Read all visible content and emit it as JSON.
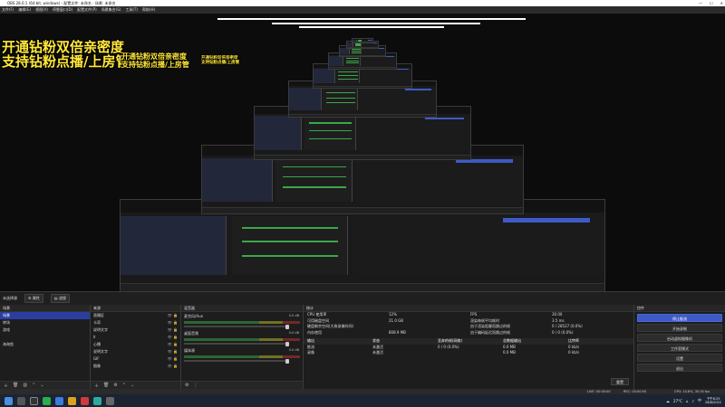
{
  "window": {
    "title": "OBS 28.0.1 (64-bit, windows) - 配置文件: 未命名 - 场景: 未命名",
    "min": "—",
    "max": "☐",
    "close": "✕"
  },
  "menu": [
    "文件(F)",
    "编辑(E)",
    "视图(V)",
    "停靠窗口(D)",
    "配置文件(P)",
    "场景集合(S)",
    "工具(T)",
    "帮助(H)"
  ],
  "overlay": {
    "line1": "开通钻粉双倍亲密度",
    "line2": "支持钻粉点播/上房管"
  },
  "scene_bar": {
    "label": "未选择源",
    "properties": "属性",
    "filters": "滤镜"
  },
  "scenes": {
    "title": "场景",
    "items": [
      "场景",
      "转场",
      "游戏",
      "",
      "海海鱼"
    ],
    "selected": 0
  },
  "sources": {
    "title": "来源",
    "items": [
      "直播区",
      "卡奇",
      "说明文字",
      "Ir",
      "心播",
      "说明文字",
      "GIF",
      "图像"
    ]
  },
  "mixer": {
    "title": "混音器",
    "channels": [
      {
        "name": "麦克风/Aux",
        "db": "0.0 dB"
      },
      {
        "name": "桌面音频",
        "db": "0.0 dB"
      },
      {
        "name": "媒体源",
        "db": "0.0 dB"
      },
      {
        "name": "说明文字",
        "db": "0.0 dB"
      }
    ]
  },
  "stats": {
    "title": "统计",
    "rows": [
      [
        "CPU 使用率",
        "12%",
        "FPS",
        "30.00"
      ],
      [
        "可用磁盘空间",
        "21.0 GB",
        "渲染每帧平均耗时",
        "3.5 ms"
      ],
      [
        "硬盘剩余空间(大致录像时间)",
        "",
        "由于渲染阻塞而跳过的帧",
        "0 / 28527 (0.0%)"
      ],
      [
        "内存使用",
        "808.9 MB",
        "由于编码延迟而跳过的帧",
        "0 / 0 (0.0%)"
      ]
    ],
    "table_head": [
      "输出",
      "状态",
      "丢弃的帧(网络)",
      "总数据输出",
      "比特率"
    ],
    "table_rows": [
      [
        "推流",
        "未激活",
        "0 / 0 (0.0%)",
        "0.0 MB",
        "0 kb/s"
      ],
      [
        "录像",
        "未激活",
        "",
        "0.0 MB",
        "0 kb/s"
      ]
    ],
    "reset": "重置"
  },
  "controls": {
    "title": "控件",
    "buttons": [
      "停止推流",
      "开始录制",
      "启动虚拟摄像机",
      "工作室模式",
      "设置",
      "退出"
    ]
  },
  "status": {
    "live": "LIVE: 00:00:00",
    "rec": "REC: 00:00:00",
    "cpu": "CPU: 10.8%, 30.00 fps"
  },
  "taskbar": {
    "temp": "27°C",
    "lang": "中",
    "time": "下午8:25",
    "date": "28/8/2022"
  },
  "colors": {
    "accent": "#3e5ac6",
    "overlay": "#ffe83a",
    "taskbar": "#1c2431"
  }
}
